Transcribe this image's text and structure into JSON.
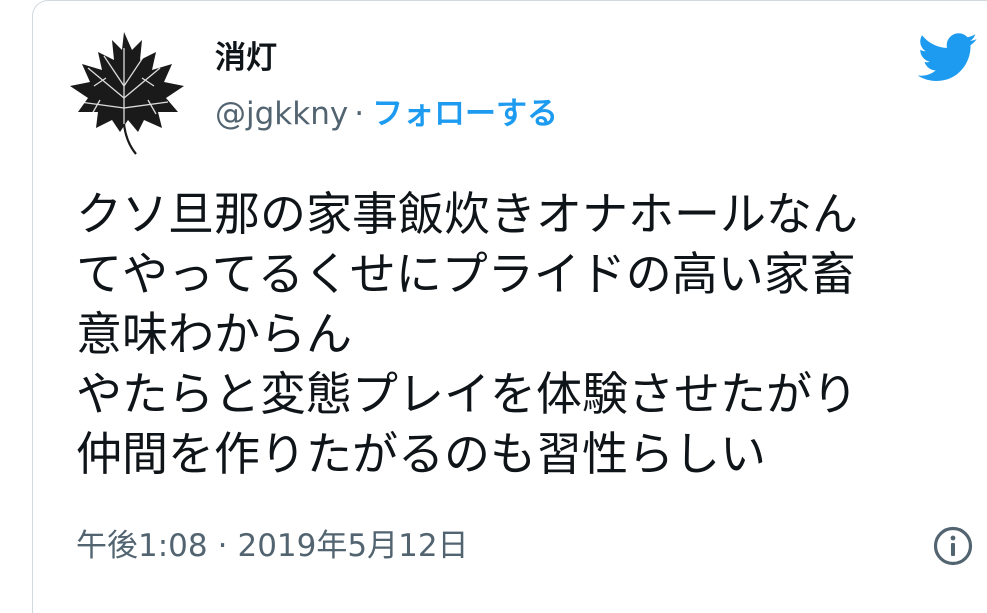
{
  "user": {
    "display_name": "消灯",
    "handle": "@jgkkny",
    "separator": "·",
    "follow_label": "フォローする"
  },
  "tweet": {
    "lines": [
      "クソ旦那の家事飯炊きオナホールなん",
      "てやってるくせにプライドの高い家畜",
      "意味わからん",
      "やたらと変態プレイを体験させたがり",
      "仲間を作りたがるのも習性らしい"
    ]
  },
  "meta": {
    "time": "午後1:08",
    "separator": "·",
    "date": "2019年5月12日"
  },
  "icons": {
    "brand": "twitter-bird-icon",
    "info": "info-icon",
    "avatar": "maple-leaf-avatar"
  },
  "colors": {
    "accent": "#1d9bf0",
    "text_primary": "#0f1419",
    "text_secondary": "#536471",
    "border": "#cfd9de"
  }
}
